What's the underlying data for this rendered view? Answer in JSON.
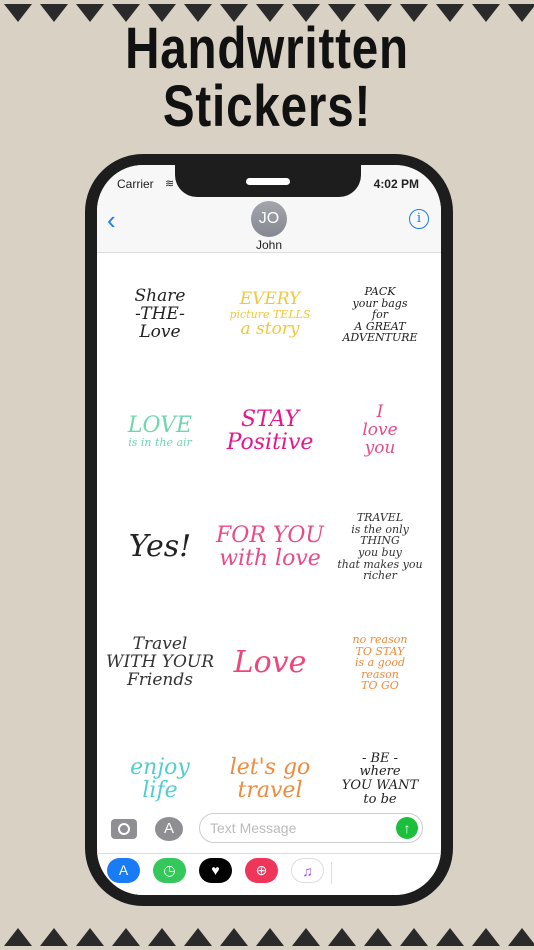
{
  "title": {
    "line1": "Handwritten",
    "line2": "Stickers!"
  },
  "status": {
    "carrier": "Carrier",
    "time": "4:02 PM"
  },
  "header": {
    "avatar_initials": "JO",
    "contact_name": "John"
  },
  "stickers": [
    {
      "lines": [
        "Share",
        "-THE-",
        "Love"
      ],
      "color": "#222222"
    },
    {
      "lines": [
        "EVERY",
        "picture TELLS",
        "a story"
      ],
      "color": "#f2c73a"
    },
    {
      "lines": [
        "PACK",
        "your bags",
        "for",
        "A GREAT",
        "ADVENTURE"
      ],
      "color": "#222222"
    },
    {
      "lines": [
        "LOVE",
        "is in the air"
      ],
      "color": "#6fd6b0"
    },
    {
      "lines": [
        "STAY",
        "Positive"
      ],
      "color": "#e8168c"
    },
    {
      "lines": [
        "I",
        "love",
        "you"
      ],
      "color": "#e94b86"
    },
    {
      "lines": [
        "Yes!"
      ],
      "color": "#222222"
    },
    {
      "lines": [
        "FOR YOU",
        "with love"
      ],
      "color": "#e94b86"
    },
    {
      "lines": [
        "TRAVEL",
        "is the only",
        "THING",
        "you buy",
        "that makes you",
        "richer"
      ],
      "color": "#333333"
    },
    {
      "lines": [
        "Travel",
        "WITH YOUR",
        "Friends"
      ],
      "color": "#333333"
    },
    {
      "lines": [
        "Love"
      ],
      "color": "#f0457a"
    },
    {
      "lines": [
        "no reason",
        "TO STAY",
        "is a good",
        "reason",
        "TO GO"
      ],
      "color": "#f08a3c"
    },
    {
      "lines": [
        "enjoy",
        "life"
      ],
      "color": "#4fcfd0"
    },
    {
      "lines": [
        "let's go",
        "travel"
      ],
      "color": "#f08a3c"
    },
    {
      "lines": [
        "- BE -",
        "where",
        "YOU WANT",
        "to be"
      ],
      "color": "#222222"
    }
  ],
  "input": {
    "placeholder": "Text Message"
  },
  "tray": [
    {
      "icon": "app-store-icon",
      "glyph": "A",
      "color": "#1a7cf5"
    },
    {
      "icon": "recents-icon",
      "glyph": "◷",
      "color": "#34c759"
    },
    {
      "icon": "digital-touch-icon",
      "glyph": "♥",
      "color": "#000000"
    },
    {
      "icon": "image-search-icon",
      "glyph": "⊕",
      "color": "#f0355a"
    },
    {
      "icon": "music-icon",
      "glyph": "♫",
      "color": "#ffffff"
    }
  ]
}
